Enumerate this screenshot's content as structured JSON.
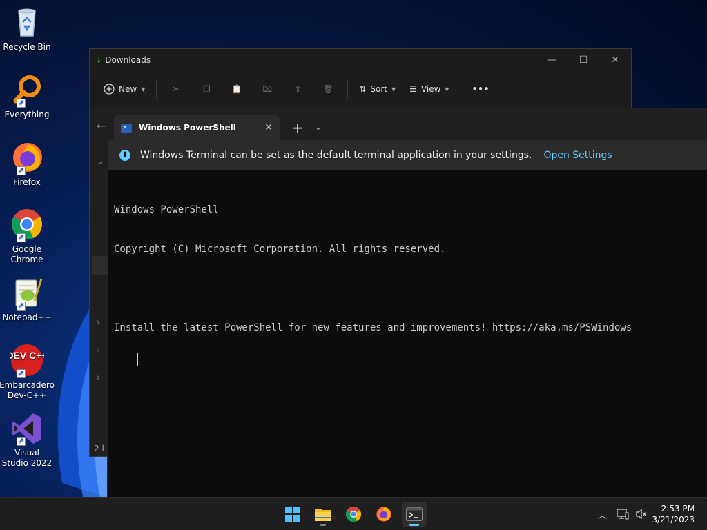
{
  "desktop": {
    "icons": [
      {
        "label": "Recycle Bin"
      },
      {
        "label": "Everything"
      },
      {
        "label": "Firefox"
      },
      {
        "label": "Google Chrome"
      },
      {
        "label": "Notepad++"
      },
      {
        "label": "Embarcadero Dev-C++"
      },
      {
        "label": "Visual Studio 2022"
      }
    ],
    "devcpp_logo_text": "DEV C++"
  },
  "explorer": {
    "title": "Downloads",
    "toolbar": {
      "new_label": "New",
      "sort_label": "Sort",
      "view_label": "View",
      "more_label": "•••"
    },
    "status_text": "2 i"
  },
  "terminal": {
    "tab_title": "Windows PowerShell",
    "infobar": {
      "message": "Windows Terminal can be set as the default terminal application in your settings.",
      "link": "Open Settings"
    },
    "console_lines": [
      "Windows PowerShell",
      "Copyright (C) Microsoft Corporation. All rights reserved.",
      "",
      "Install the latest PowerShell for new features and improvements! https://aka.ms/PSWindows"
    ]
  },
  "taskbar": {
    "time": "2:53 PM",
    "date": "3/21/2023"
  },
  "colors": {
    "accent": "#60cdff",
    "terminal_bg": "#0c0c0c",
    "taskbar_bg": "#1f1f1f"
  }
}
